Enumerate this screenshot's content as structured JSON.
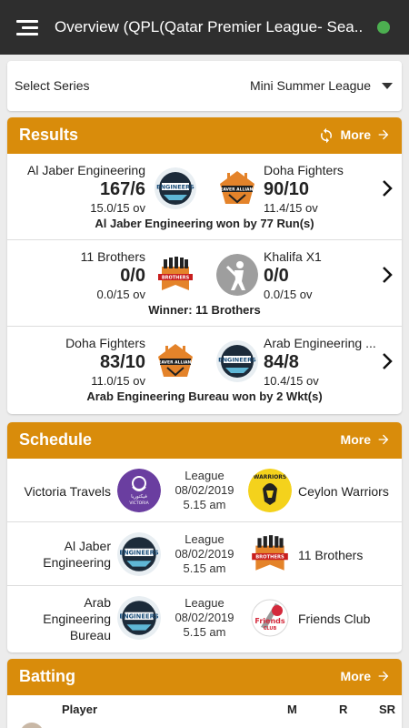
{
  "appbar": {
    "title": "Overview (QPL(Qatar Premier League- Sea...",
    "status_color": "#4caf50"
  },
  "series": {
    "label": "Select Series",
    "selected": "Mini Summer League"
  },
  "accent_color": "#d98c0b",
  "results": {
    "title": "Results",
    "more_label": "More",
    "matches": [
      {
        "team1": "Al Jaber Engineering",
        "score1": "167/6",
        "overs1": "15.0/15 ov",
        "logo1": "engineers-logo",
        "team2": "Doha Fighters",
        "score2": "90/10",
        "overs2": "11.4/15 ov",
        "logo2": "weaver-alliance-logo",
        "summary": "Al Jaber Engineering won by 77 Run(s)"
      },
      {
        "team1": "11 Brothers",
        "score1": "0/0",
        "overs1": "0.0/15 ov",
        "logo1": "brothers-logo",
        "team2": "Khalifa X1",
        "score2": "0/0",
        "overs2": "0.0/15 ov",
        "logo2": "batsman-placeholder-logo",
        "summary": "Winner: 11 Brothers"
      },
      {
        "team1": "Doha Fighters",
        "score1": "83/10",
        "overs1": "11.0/15 ov",
        "logo1": "weaver-alliance-logo",
        "team2": "Arab Engineering ...",
        "score2": "84/8",
        "overs2": "10.4/15 ov",
        "logo2": "engineers-logo",
        "summary": "Arab Engineering Bureau won by 2 Wkt(s)"
      }
    ]
  },
  "schedule": {
    "title": "Schedule",
    "more_label": "More",
    "fixtures": [
      {
        "team1": "Victoria Travels",
        "logo1": "victoria-travels-logo",
        "type": "League",
        "date": "08/02/2019",
        "time": "5.15 am",
        "team2": "Ceylon Warriors",
        "logo2": "ceylon-warriors-logo"
      },
      {
        "team1": "Al Jaber Engineering",
        "logo1": "engineers-logo",
        "type": "League",
        "date": "08/02/2019",
        "time": "5.15 am",
        "team2": "11 Brothers",
        "logo2": "brothers-logo"
      },
      {
        "team1": "Arab Engineering Bureau",
        "logo1": "engineers-logo",
        "type": "League",
        "date": "08/02/2019",
        "time": "5.15 am",
        "team2": "Friends Club",
        "logo2": "friends-club-logo"
      }
    ]
  },
  "batting": {
    "title": "Batting",
    "more_label": "More",
    "columns": [
      "Player",
      "M",
      "R",
      "SR"
    ]
  }
}
